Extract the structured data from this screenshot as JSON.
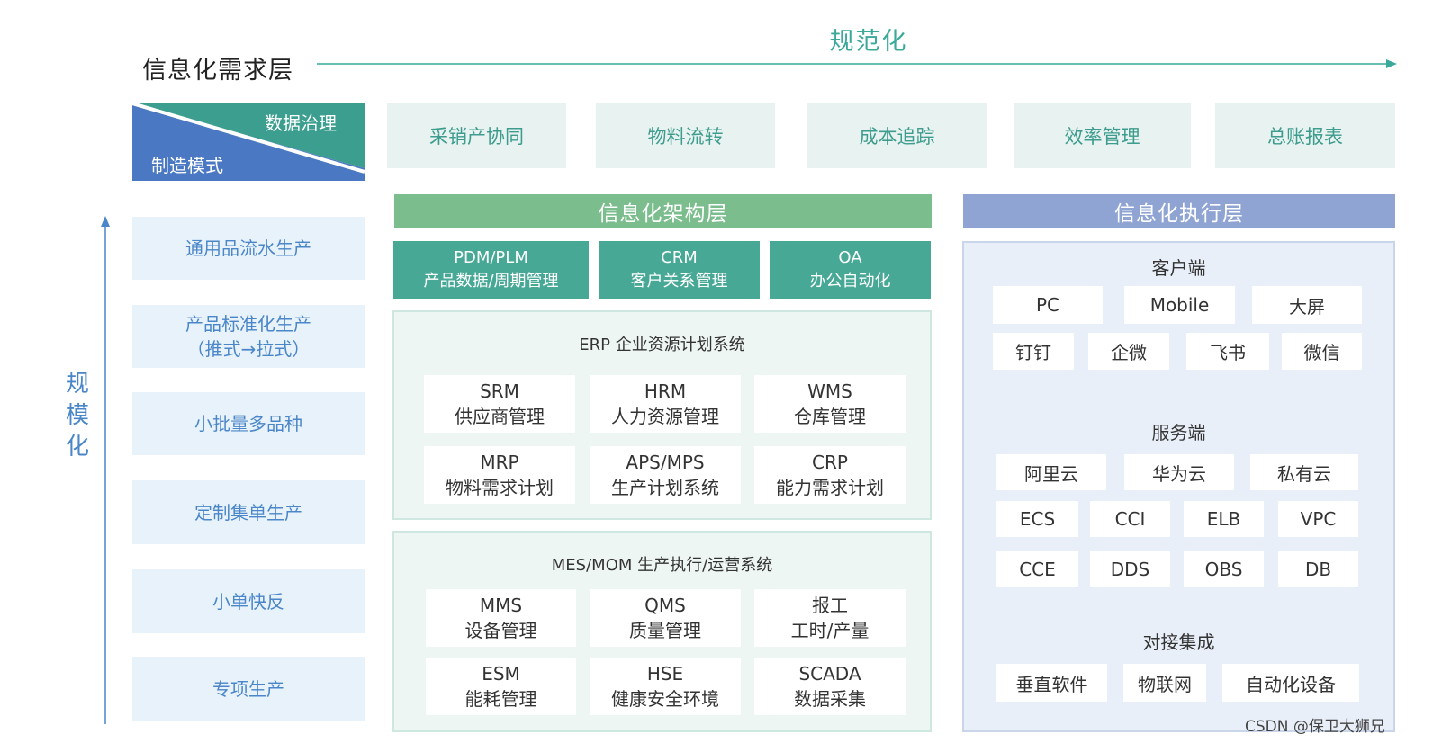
{
  "top": {
    "title": "信息化需求层",
    "axis_label": "规范化"
  },
  "corner": {
    "top_label": "数据治理",
    "bottom_label": "制造模式"
  },
  "demands": [
    "采销产协同",
    "物料流转",
    "成本追踪",
    "效率管理",
    "总账报表"
  ],
  "left_axis": {
    "label_chars": [
      "规",
      "模",
      "化"
    ]
  },
  "modes": [
    {
      "line1": "通用品流水生产",
      "line2": ""
    },
    {
      "line1": "产品标准化生产",
      "line2": "（推式→拉式）"
    },
    {
      "line1": "小批量多品种",
      "line2": ""
    },
    {
      "line1": "定制集单生产",
      "line2": ""
    },
    {
      "line1": "小单快反",
      "line2": ""
    },
    {
      "line1": "专项生产",
      "line2": ""
    }
  ],
  "architecture": {
    "header": "信息化架构层",
    "top_items": [
      {
        "line1": "PDM/PLM",
        "line2": "产品数据/周期管理"
      },
      {
        "line1": "CRM",
        "line2": "客户关系管理"
      },
      {
        "line1": "OA",
        "line2": "办公自动化"
      }
    ],
    "erp": {
      "title": "ERP 企业资源计划系统",
      "items": [
        {
          "line1": "SRM",
          "line2": "供应商管理"
        },
        {
          "line1": "HRM",
          "line2": "人力资源管理"
        },
        {
          "line1": "WMS",
          "line2": "仓库管理"
        },
        {
          "line1": "MRP",
          "line2": "物料需求计划"
        },
        {
          "line1": "APS/MPS",
          "line2": "生产计划系统"
        },
        {
          "line1": "CRP",
          "line2": "能力需求计划"
        }
      ]
    },
    "mes": {
      "title": "MES/MOM 生产执行/运营系统",
      "items": [
        {
          "line1": "MMS",
          "line2": "设备管理"
        },
        {
          "line1": "QMS",
          "line2": "质量管理"
        },
        {
          "line1": "报工",
          "line2": "工时/产量"
        },
        {
          "line1": "ESM",
          "line2": "能耗管理"
        },
        {
          "line1": "HSE",
          "line2": "健康安全环境"
        },
        {
          "line1": "SCADA",
          "line2": "数据采集"
        }
      ]
    }
  },
  "execution": {
    "header": "信息化执行层",
    "client": {
      "title": "客户端",
      "row1": [
        "PC",
        "Mobile",
        "大屏"
      ],
      "row2": [
        "钉钉",
        "企微",
        "飞书",
        "微信"
      ]
    },
    "server": {
      "title": "服务端",
      "row1": [
        "阿里云",
        "华为云",
        "私有云"
      ],
      "row2": [
        "ECS",
        "CCI",
        "ELB",
        "VPC"
      ],
      "row3": [
        "CCE",
        "DDS",
        "OBS",
        "DB"
      ]
    },
    "integration": {
      "title": "对接集成",
      "row1": [
        "垂直软件",
        "物联网",
        "自动化设备"
      ]
    }
  },
  "watermark": "CSDN @保卫大狮兄",
  "colors": {
    "teal_text": "#3d9c8d",
    "demand_bg": "#e8f3f1",
    "blue_text": "#4a86c8",
    "mode_bg": "#e8f2fb",
    "arch_header": "#7bbd8d",
    "arch_top": "#48a896",
    "exec_header": "#8fa4d3",
    "exec_bg": "#e9eff8"
  }
}
